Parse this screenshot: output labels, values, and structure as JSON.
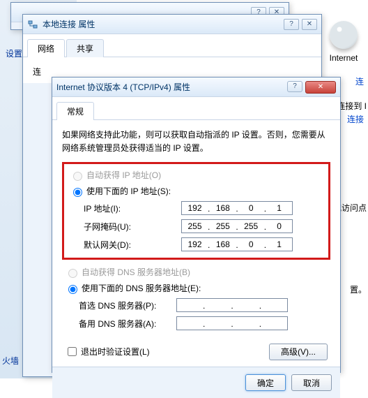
{
  "background": {
    "settings_label": "设置",
    "firewall_label": "火墙"
  },
  "right": {
    "internet_label": "Internet",
    "link1": "连",
    "text1": "连接到 I",
    "link2": "连接",
    "text2": "或访问点",
    "text3": "置。"
  },
  "win1": {
    "title": ""
  },
  "win2": {
    "title": "本地连接 属性",
    "tabs": [
      "网络",
      "共享"
    ],
    "connect_label": "连"
  },
  "win3": {
    "title": "Internet 协议版本 4 (TCP/IPv4) 属性",
    "tab": "常规",
    "help": "如果网络支持此功能，则可以获取自动指派的 IP 设置。否则，您需要从网络系统管理员处获得适当的 IP 设置。",
    "radio_auto_ip": "自动获得 IP 地址(O)",
    "radio_manual_ip": "使用下面的 IP 地址(S):",
    "ip_label": "IP 地址(I):",
    "subnet_label": "子网掩码(U):",
    "gateway_label": "默认网关(D):",
    "ip": [
      "192",
      "168",
      "0",
      "1"
    ],
    "subnet": [
      "255",
      "255",
      "255",
      "0"
    ],
    "gateway": [
      "192",
      "168",
      "0",
      "1"
    ],
    "radio_auto_dns": "自动获得 DNS 服务器地址(B)",
    "radio_manual_dns": "使用下面的 DNS 服务器地址(E):",
    "dns1_label": "首选 DNS 服务器(P):",
    "dns2_label": "备用 DNS 服务器(A):",
    "dns1": [
      "",
      "",
      "",
      ""
    ],
    "dns2": [
      "",
      "",
      "",
      ""
    ],
    "validate_label": "退出时验证设置(L)",
    "advanced_btn": "高级(V)...",
    "ok_btn": "确定",
    "cancel_btn": "取消"
  }
}
